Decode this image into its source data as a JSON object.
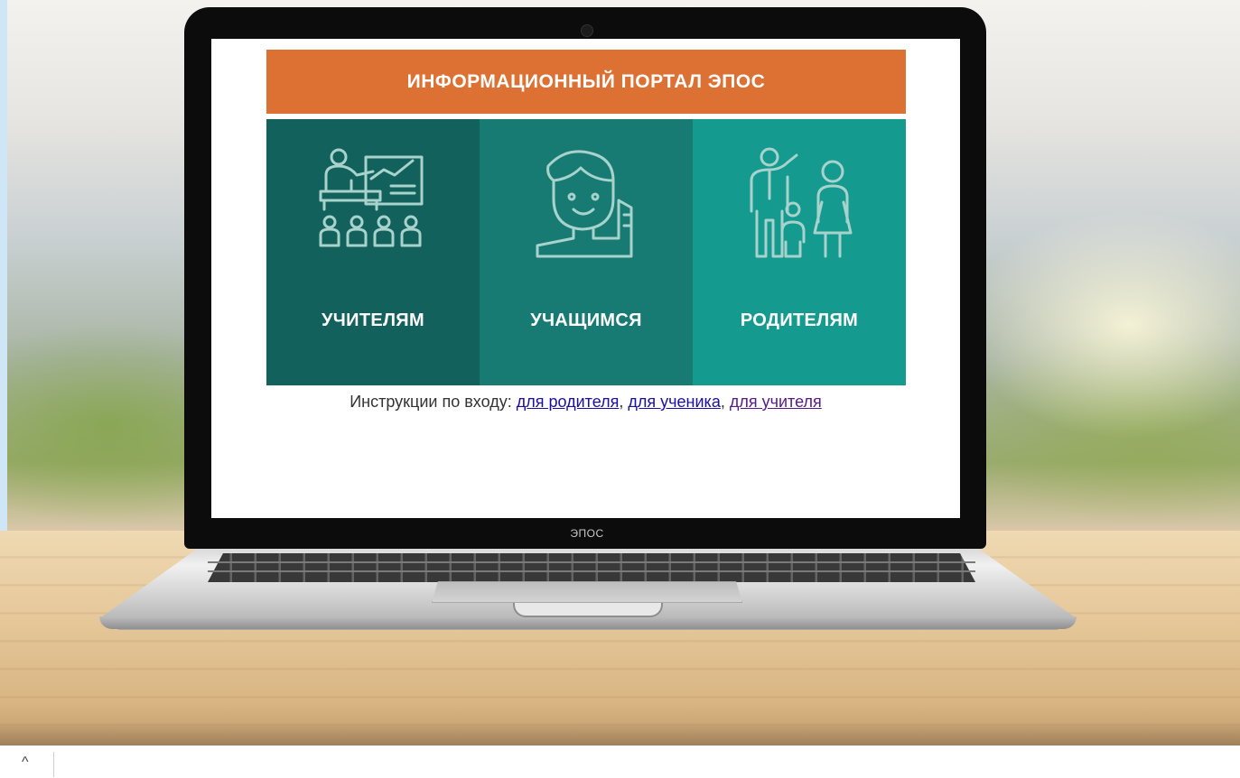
{
  "portal": {
    "title": "ИНФОРМАЦИОННЫЙ ПОРТАЛ ЭПОС",
    "colors": {
      "header": "#dd7134",
      "tile_teachers": "#12615d",
      "tile_students": "#177a73",
      "tile_parents": "#159a8f"
    },
    "tiles": [
      {
        "label": "УЧИТЕЛЯМ",
        "icon": "teacher-classroom-icon"
      },
      {
        "label": "УЧАЩИМСЯ",
        "icon": "student-icon"
      },
      {
        "label": "РОДИТЕЛЯМ",
        "icon": "family-icon"
      }
    ],
    "instructions": {
      "prefix": "Инструкции по входу:",
      "links": [
        "для родителя",
        "для ученика",
        "для учителя"
      ],
      "sep1": ",",
      "sep2": ","
    }
  },
  "laptop": {
    "brand": "ЭПОС"
  },
  "bottom_bar": {
    "toggle_icon": "chevron-up-icon",
    "toggle_glyph": "^"
  }
}
